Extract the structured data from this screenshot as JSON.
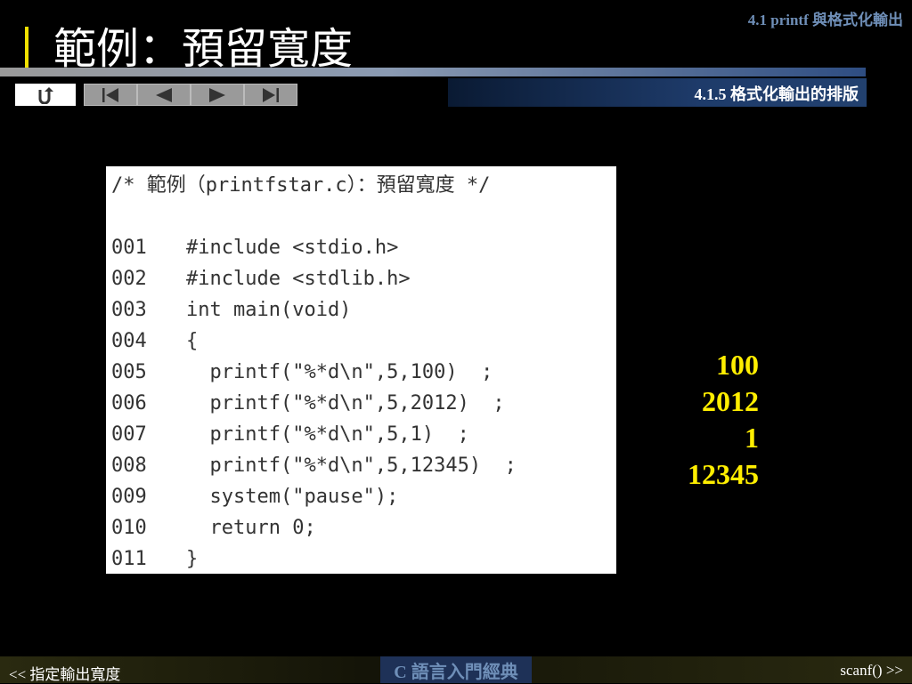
{
  "header": {
    "chapter": "4.1  printf 與格式化輸出",
    "title": "範例：預留寬度",
    "section": "4.1.5 格式化輸出的排版"
  },
  "nav": {
    "icons": [
      "return-icon",
      "first-page-icon",
      "previous-page-icon",
      "next-page-icon",
      "last-page-icon"
    ]
  },
  "code": {
    "comment": "/* 範例（printfstar.c）：預留寬度 */",
    "lines": [
      {
        "no": "001",
        "text": "#include <stdio.h>"
      },
      {
        "no": "002",
        "text": "#include <stdlib.h>"
      },
      {
        "no": "003",
        "text": "int main(void)"
      },
      {
        "no": "004",
        "text": "{"
      },
      {
        "no": "005",
        "text": "  printf(\"%*d\\n\",5,100)  ;"
      },
      {
        "no": "006",
        "text": "  printf(\"%*d\\n\",5,2012)  ;"
      },
      {
        "no": "007",
        "text": "  printf(\"%*d\\n\",5,1)  ;"
      },
      {
        "no": "008",
        "text": "  printf(\"%*d\\n\",5,12345)  ;"
      },
      {
        "no": "009",
        "text": "  system(\"pause\");"
      },
      {
        "no": "010",
        "text": "  return 0;"
      },
      {
        "no": "011",
        "text": "}"
      }
    ]
  },
  "output": [
    "100",
    "2012",
    "1",
    "12345"
  ],
  "footer": {
    "prev": "<< 指定輸出寬度",
    "book": "C 語言入門經典",
    "next": "scanf() >>"
  },
  "colors": {
    "title_bar": "#f0e000",
    "output_text": "#ffee00",
    "header_blue": "#6f8fb8"
  }
}
